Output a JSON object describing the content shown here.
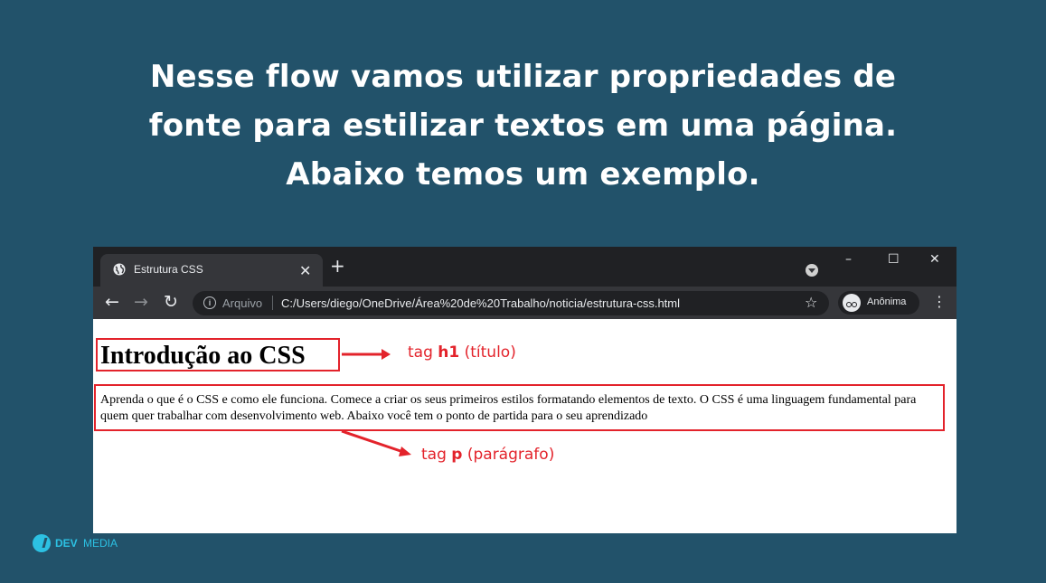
{
  "slide": {
    "headline": [
      "Nesse flow vamos utilizar propriedades de",
      "fonte para estilizar textos em uma página.",
      "Abaixo temos um exemplo."
    ]
  },
  "browser": {
    "tab_title": "Estrutura CSS",
    "tab_close": "✕",
    "new_tab": "+",
    "window_controls": {
      "minimize": "–",
      "maximize": "☐",
      "close": "✕"
    },
    "address": {
      "protocol_label": "Arquivo",
      "url": "C:/Users/diego/OneDrive/Área%20de%20Trabalho/noticia/estrutura-css.html"
    },
    "profile_label": "Anônima",
    "icons": [
      "globe-icon",
      "back-icon",
      "forward-icon",
      "reload-icon",
      "info-icon",
      "star-icon",
      "incognito-icon",
      "menu-icon"
    ]
  },
  "page": {
    "h1": "Introdução ao CSS",
    "paragraph": "Aprenda o que é o CSS e como ele funciona. Comece a criar os seus primeiros estilos formatando elementos de texto. O CSS é uma linguagem fundamental para quem quer trabalhar com desenvolvimento web. Abaixo você tem o ponto de partida para o seu aprendizado"
  },
  "annotations": {
    "h1": {
      "prefix": "tag ",
      "tag": "h1",
      "suffix": " (título)"
    },
    "p": {
      "prefix": "tag ",
      "tag": "p",
      "suffix": " (parágrafo)"
    }
  },
  "logo": {
    "dev": "DEV",
    "media": "MEDIA"
  },
  "colors": {
    "background": "#22526a",
    "highlight": "#e3232b",
    "chrome_dark": "#202124",
    "chrome_toolbar": "#35363a",
    "brand": "#2cc1e3"
  }
}
